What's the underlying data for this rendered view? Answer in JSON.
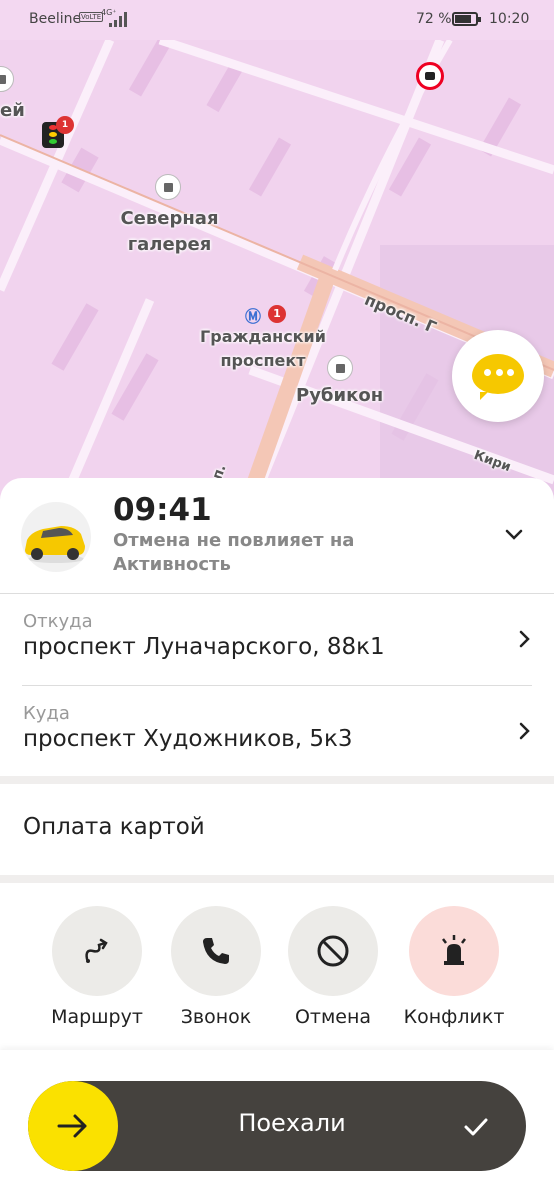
{
  "status_bar": {
    "carrier": "Beeline",
    "volte": "VoLTE",
    "network": "4G⁺",
    "battery_percent": "72 %",
    "battery_level": 0.72,
    "time": "10:20"
  },
  "map": {
    "labels": {
      "partial_left": "ей",
      "severnaya_galereya_line1": "Северная",
      "severnaya_galereya_line2": "галерея",
      "metro_line1": "Гражданский",
      "metro_line2": "проспект",
      "metro_line_number": "1",
      "rubikon": "Рубикон",
      "prospekt_road": "просп. Г",
      "kirill_partial": "Кири",
      "road_p": "п.",
      "cam_badge": "1"
    }
  },
  "order": {
    "eta": "09:41",
    "eta_note": "Отмена не повлияет на Активность",
    "from_label": "Откуда",
    "from_value": "проспект Луначарского, 88к1",
    "to_label": "Куда",
    "to_value": "проспект Художников, 5к3",
    "payment": "Оплата картой"
  },
  "actions": [
    {
      "label": "Маршрут",
      "icon": "route-icon"
    },
    {
      "label": "Звонок",
      "icon": "phone-icon"
    },
    {
      "label": "Отмена",
      "icon": "cancel-icon"
    },
    {
      "label": "Конфликт",
      "icon": "siren-icon"
    }
  ],
  "go_button": {
    "label": "Поехали"
  },
  "colors": {
    "map_bg": "#f1d3ee",
    "accent_yellow": "#fae100",
    "slider_bg": "#45423e",
    "danger_bg": "#fbdcd9"
  }
}
